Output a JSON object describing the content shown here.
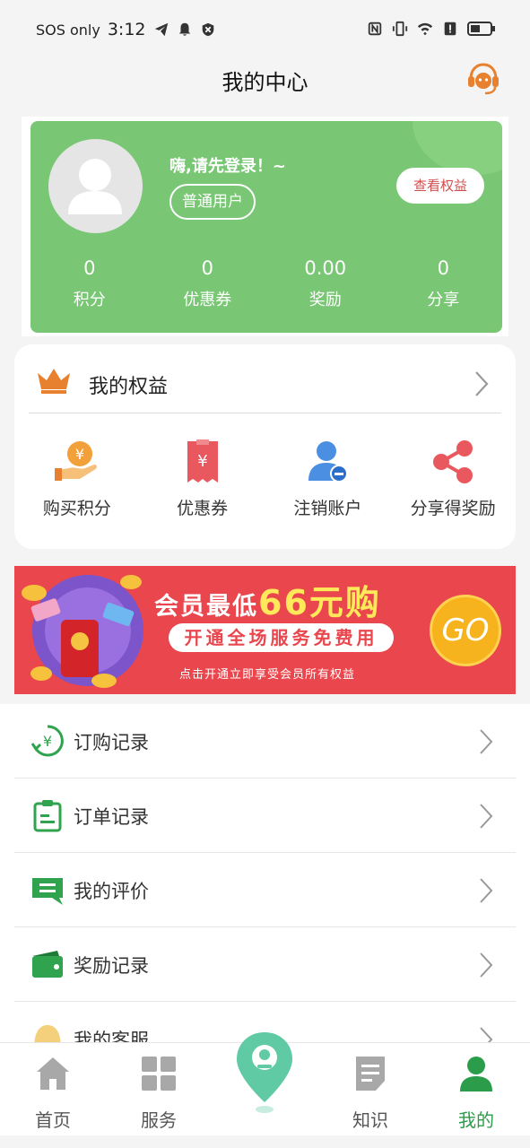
{
  "status_bar": {
    "carrier": "SOS only",
    "time": "3:12"
  },
  "header": {
    "title": "我的中心"
  },
  "profile": {
    "greeting": "嗨,请先登录！~",
    "user_type": "普通用户",
    "view_benefits_label": "查看权益",
    "stats": [
      {
        "value": "0",
        "label": "积分"
      },
      {
        "value": "0",
        "label": "优惠券"
      },
      {
        "value": "0.00",
        "label": "奖励"
      },
      {
        "value": "0",
        "label": "分享"
      }
    ]
  },
  "benefits": {
    "title": "我的权益",
    "items": [
      {
        "label": "购买积分",
        "icon": "buy-points-icon"
      },
      {
        "label": "优惠券",
        "icon": "coupon-icon"
      },
      {
        "label": "注销账户",
        "icon": "cancel-account-icon"
      },
      {
        "label": "分享得奖励",
        "icon": "share-icon"
      }
    ]
  },
  "banner": {
    "line1_prefix": "会员最低",
    "line1_highlight": "66元购",
    "line2": "开通全场服务免费用",
    "line3": "点击开通立即享受会员所有权益",
    "go_label": "GO"
  },
  "menu": [
    {
      "label": "订购记录",
      "icon": "subscription-record-icon"
    },
    {
      "label": "订单记录",
      "icon": "order-record-icon"
    },
    {
      "label": "我的评价",
      "icon": "review-icon"
    },
    {
      "label": "奖励记录",
      "icon": "wallet-icon"
    },
    {
      "label": "我的客服",
      "icon": "customer-service-icon"
    }
  ],
  "bottom_nav": {
    "items": [
      {
        "label": "首页",
        "icon": "home-icon"
      },
      {
        "label": "服务",
        "icon": "grid-icon"
      },
      {
        "label": "知识",
        "icon": "document-icon"
      },
      {
        "label": "我的",
        "icon": "user-icon"
      }
    ],
    "active": "我的"
  },
  "colors": {
    "primary_green": "#79c774",
    "active_nav": "#2b9c4a",
    "banner_red": "#e9474d",
    "accent_orange": "#e8812f"
  }
}
